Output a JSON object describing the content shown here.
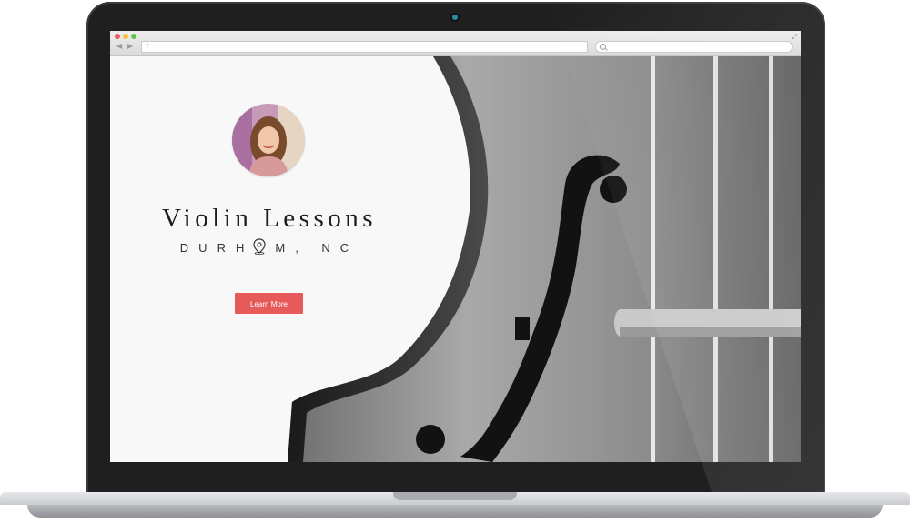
{
  "hero": {
    "title": "Violin Lessons",
    "location_part1": "DURH",
    "location_icon": "map-pin-icon",
    "location_part2": "M, NC",
    "cta_label": "Learn More"
  },
  "browser": {
    "nav_back": "◀",
    "nav_forward": "▶",
    "new_tab": "+",
    "expand": "⤢"
  },
  "colors": {
    "cta": "#e65a5a",
    "bezel": "#1f1f20"
  }
}
